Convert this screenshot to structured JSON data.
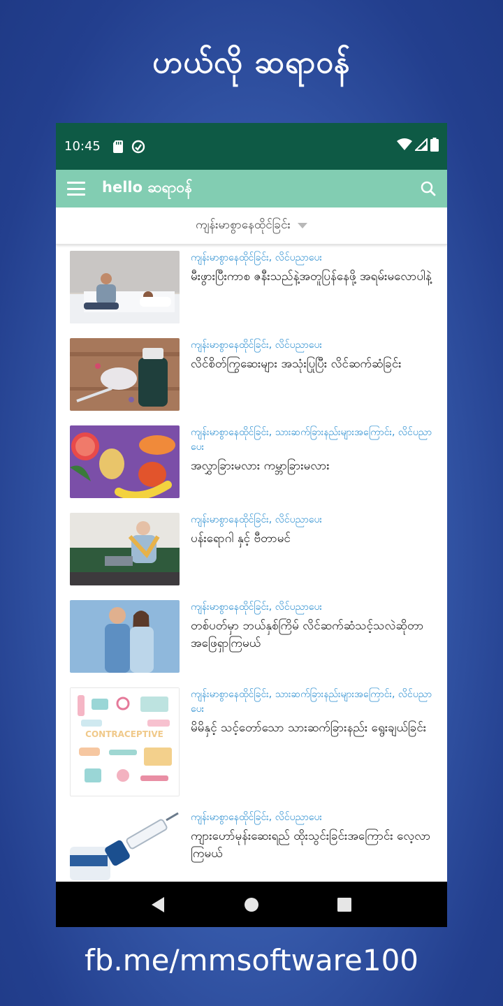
{
  "promo": {
    "title": "ဟယ်လို ဆရာဝန်",
    "footer": "fb.me/mmsoftware100"
  },
  "status_bar": {
    "time": "10:45",
    "icons": [
      "sd-card-icon",
      "sync-icon",
      "wifi-icon",
      "signal-icon",
      "battery-icon"
    ]
  },
  "app_bar": {
    "logo": "hello ဆရာဝန်",
    "menu_icon": "hamburger-menu-icon",
    "search_icon": "search-icon",
    "bar_color": "#82cdb2"
  },
  "filter": {
    "selected": "ကျန်းမာစွာနေထိုင်ခြင်း"
  },
  "articles": [
    {
      "categories": "ကျန်းမာစွာနေထိုင်ခြင်း, လိင်ပညာပေး",
      "title": "မီးဖွားပြီးကာစ ဇနီးသည်နဲ့အတူပြန်နေဖို့ အရမ်းမလောပါနဲ့"
    },
    {
      "categories": "ကျန်းမာစွာနေထိုင်ခြင်း, လိင်ပညာပေး",
      "title": "လိင်စိတ်ကြွဆေးများ အသုံးပြုပြီး လိင်ဆက်ဆံခြင်း"
    },
    {
      "categories": "ကျန်းမာစွာနေထိုင်ခြင်း, သားဆက်ခြားနည်းများအကြောင်း, လိင်ပညာပေး",
      "title": "အလွှာခြားမလား ကမ္ဘာခြားမလား"
    },
    {
      "categories": "ကျန်းမာစွာနေထိုင်ခြင်း, လိင်ပညာပေး",
      "title": "ပန်းရောဂါ နှင့် ဗီတာမင်"
    },
    {
      "categories": "ကျန်းမာစွာနေထိုင်ခြင်း, လိင်ပညာပေး",
      "title": "တစ်ပတ်မှာ ဘယ်နှစ်ကြိမ် လိင်ဆက်ဆံသင့်သလဲဆိုတာ အဖြေရှာကြမယ်"
    },
    {
      "categories": "ကျန်းမာစွာနေထိုင်ခြင်း, သားဆက်ခြားနည်းများအကြောင်း, လိင်ပညာပေး",
      "title": "မိမိနှင့် သင့်တော်သော သားဆက်ခြားနည်း ရွေးချယ်ခြင်း",
      "image_text": "CONTRACEPTIVE"
    },
    {
      "categories": "ကျန်းမာစွာနေထိုင်ခြင်း, လိင်ပညာပေး",
      "title": "ကျားဟော်မုန်းဆေးရည် ထိုးသွင်းခြင်းအကြောင်း လေ့လာကြမယ်"
    }
  ],
  "nav_bar": {
    "icons": [
      "back-icon",
      "home-icon",
      "recents-icon"
    ]
  }
}
